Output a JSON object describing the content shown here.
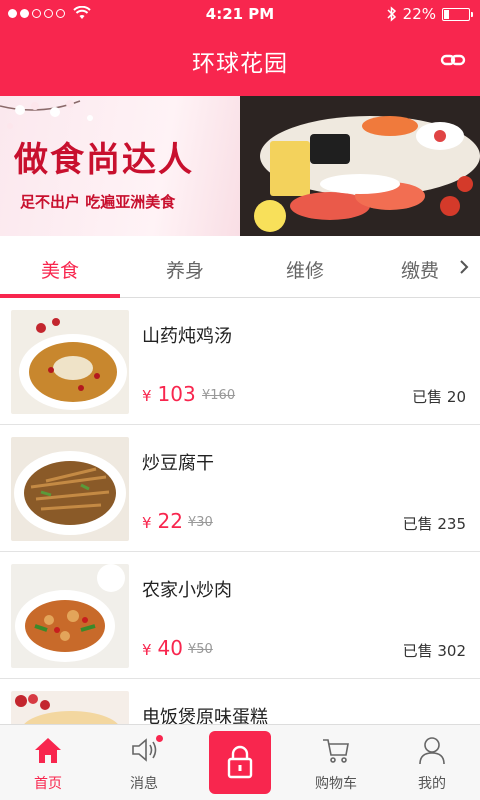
{
  "status_bar": {
    "time": "4:21 PM",
    "battery": "22%",
    "battery_level": 0.22
  },
  "header": {
    "title": "环球花园"
  },
  "banner": {
    "headline": "做食尚达人",
    "subtitle": "足不出户 吃遍亚洲美食"
  },
  "tabs": [
    {
      "label": "美食",
      "active": true
    },
    {
      "label": "养身",
      "active": false
    },
    {
      "label": "维修",
      "active": false
    },
    {
      "label": "缴费",
      "active": false
    }
  ],
  "products": [
    {
      "name": "山药炖鸡汤",
      "currency": "¥",
      "price": "103",
      "old_price": "¥160",
      "sold": "已售 20"
    },
    {
      "name": "炒豆腐干",
      "currency": "¥",
      "price": "22",
      "old_price": "¥30",
      "sold": "已售 235"
    },
    {
      "name": "农家小炒肉",
      "currency": "¥",
      "price": "40",
      "old_price": "¥50",
      "sold": "已售 302"
    },
    {
      "name": "电饭煲原味蛋糕",
      "currency": "",
      "price": "",
      "old_price": "",
      "sold": ""
    }
  ],
  "bottom_nav": [
    {
      "label": "首页",
      "icon": "home-icon",
      "active": true
    },
    {
      "label": "消息",
      "icon": "speaker-icon",
      "active": false
    },
    {
      "label": "",
      "icon": "lock-icon",
      "active": false
    },
    {
      "label": "购物车",
      "icon": "cart-icon",
      "active": false
    },
    {
      "label": "我的",
      "icon": "user-icon",
      "active": false
    }
  ],
  "colors": {
    "accent": "#f8264e",
    "text": "#333333",
    "muted": "#999999"
  }
}
